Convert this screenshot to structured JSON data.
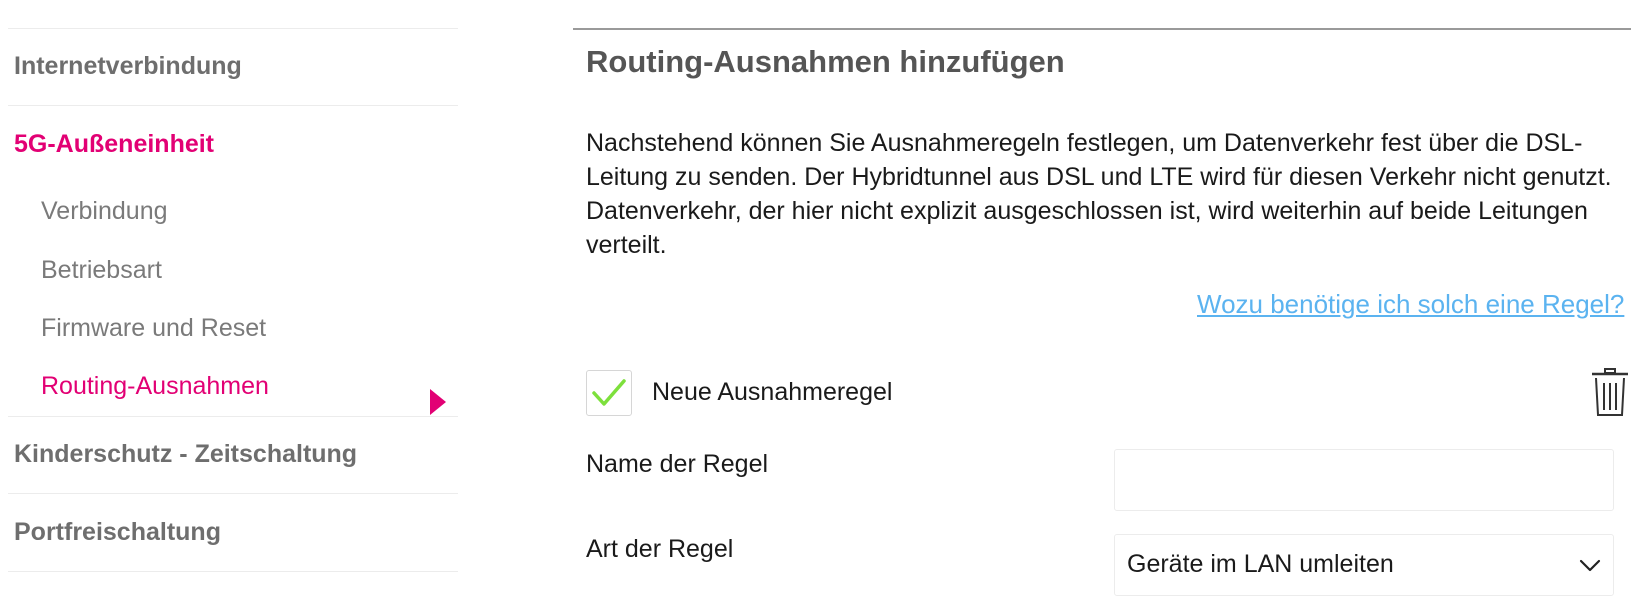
{
  "sidebar": {
    "items": [
      {
        "label": "Internetverbindung"
      },
      {
        "label": "5G-Außeneinheit"
      },
      {
        "label": "Kinderschutz - Zeitschaltung"
      },
      {
        "label": "Portfreischaltung"
      }
    ],
    "subitems": [
      {
        "label": "Verbindung"
      },
      {
        "label": "Betriebsart"
      },
      {
        "label": "Firmware und Reset"
      },
      {
        "label": "Routing-Ausnahmen"
      }
    ]
  },
  "main": {
    "title": "Routing-Ausnahmen hinzufügen",
    "description": "Nachstehend können Sie Ausnahmeregeln festlegen, um Datenverkehr fest über die DSL-Leitung zu senden. Der Hybridtunnel aus DSL und LTE wird für diesen Verkehr nicht genutzt. Datenverkehr, der hier nicht explizit ausgeschlossen ist, wird weiterhin auf beide Leitungen verteilt.",
    "help_link": "Wozu benötige ich solch eine Regel?",
    "rule": {
      "title": "Neue Ausnahmeregel",
      "checked": true,
      "name_label": "Name der Regel",
      "name_value": "",
      "type_label": "Art der Regel",
      "type_value": "Geräte im LAN umleiten"
    }
  },
  "colors": {
    "accent": "#e20074",
    "link": "#5bb3f0",
    "check": "#7de03c"
  },
  "icons": {
    "active_marker": "triangle-right-icon",
    "checkbox": "checkmark-icon",
    "delete": "trash-icon",
    "dropdown": "chevron-down-icon"
  }
}
